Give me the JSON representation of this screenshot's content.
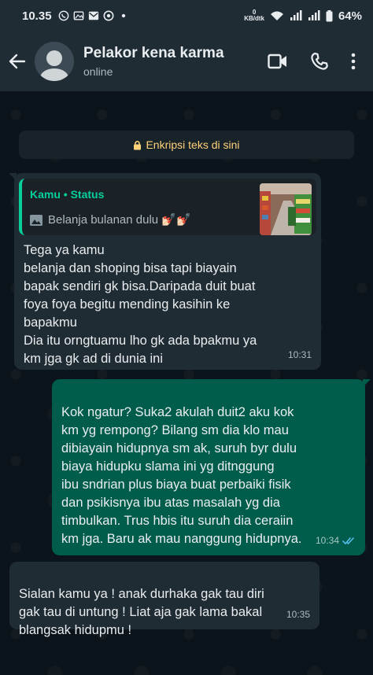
{
  "status_bar": {
    "time": "10.35",
    "speed_value": "0",
    "speed_unit": "KB/dtk",
    "battery": "64%",
    "icons": [
      "whatsapp-icon",
      "image-icon",
      "mail-icon",
      "app-icon",
      "dot-icon",
      "wifi-icon",
      "signal-icon",
      "battery-icon"
    ]
  },
  "header": {
    "name": "Pelakor kena karma",
    "status": "online",
    "actions": [
      "video-call-icon",
      "voice-call-icon",
      "more-options-icon"
    ]
  },
  "encryption_notice": "Enkripsi teks di sini",
  "messages": [
    {
      "direction": "incoming",
      "quote": {
        "sender": "Kamu • Status",
        "text": "Belanja bulanan dulu 💅🏻💅🏻"
      },
      "text": "Tega ya kamu\nbelanja dan shoping bisa tapi biayain\nbapak sendiri gk bisa.Daripada duit buat\nfoya foya begitu mending kasihin ke\nbapakmu\nDia itu orngtuamu lho gk ada bpakmu ya\nkm jga gk ad di dunia ini",
      "time": "10:31"
    },
    {
      "direction": "outgoing",
      "text": "Kok ngatur? Suka2 akulah duit2 aku kok\nkm yg rempong? Bilang sm dia klo mau\ndibiayain hidupnya sm ak, suruh byr dulu\nbiaya hidupku slama ini yg ditnggung\nibu sndrian plus biaya buat perbaiki fisik\ndan psikisnya ibu atas masalah yg dia\ntimbulkan. Trus hbis itu suruh dia ceraiin\nkm jga. Baru ak mau nanggung hidupnya.",
      "time": "10:34",
      "read": true
    },
    {
      "direction": "incoming",
      "text": "Sialan kamu ya ! anak durhaka gak tau diri\ngak tau di untung ! Liat aja gak lama bakal\nblangsak hidupmu !",
      "time": "10:35"
    }
  ],
  "colors": {
    "app_bar": "#1f2c34",
    "background": "#0b141a",
    "incoming_bubble": "#202c33",
    "outgoing_bubble": "#005c4b",
    "accent": "#06cf9c",
    "read_ticks": "#53bdeb",
    "encryption_text": "#ffd279"
  }
}
